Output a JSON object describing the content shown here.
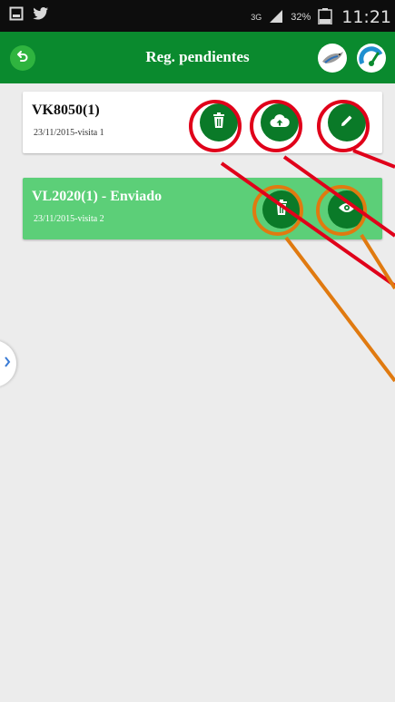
{
  "status_bar": {
    "network": "3G",
    "battery": "32%",
    "time": "11:21"
  },
  "app_bar": {
    "title": "Reg. pendientes"
  },
  "records": [
    {
      "title": "VK8050(1)",
      "subtitle": "23/11/2015-visita 1",
      "actions": [
        "delete",
        "upload",
        "edit"
      ]
    },
    {
      "title": "VL2020(1) - Enviado",
      "subtitle": "23/11/2015-visita 2",
      "actions": [
        "delete",
        "view"
      ]
    }
  ],
  "colors": {
    "primary": "#0a8a2e",
    "sent_row": "#5ccf78",
    "action_button": "#0a7a28",
    "annotation_red": "#e0001a",
    "annotation_orange": "#e07a10"
  },
  "icons": [
    "back-icon",
    "bird-icon",
    "gauge-icon",
    "trash-icon",
    "cloud-upload-icon",
    "pencil-icon",
    "eye-icon",
    "chevron-right-icon"
  ]
}
